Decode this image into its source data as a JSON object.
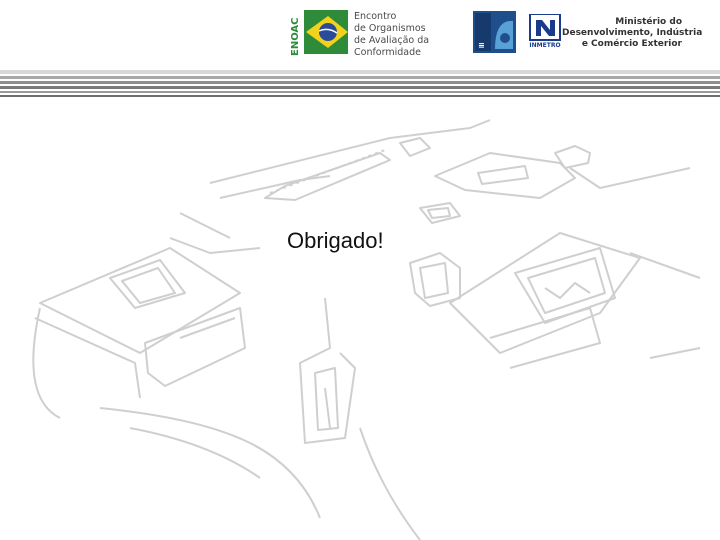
{
  "header": {
    "enoac": {
      "vertical_label": "ENOAC",
      "name_lines": [
        "Encontro",
        "de Organismos",
        "de Avaliação da",
        "Conformidade"
      ]
    },
    "inmetro_label": "INMETRO",
    "ministry_lines": [
      "Ministério do",
      "Desenvolvimento, Indústria",
      "e Comércio Exterior"
    ]
  },
  "slide": {
    "message": "Obrigado!"
  },
  "colors": {
    "enoac_green": "#2e8b3a",
    "enoac_yellow": "#f2d21b",
    "enoac_blue": "#2a4a9a",
    "cgcre_blue": "#1f4e8c",
    "inmetro_blue": "#1a3b8c",
    "stripe_gray": "#8e8e8e",
    "map_line": "#cfcfcf"
  }
}
